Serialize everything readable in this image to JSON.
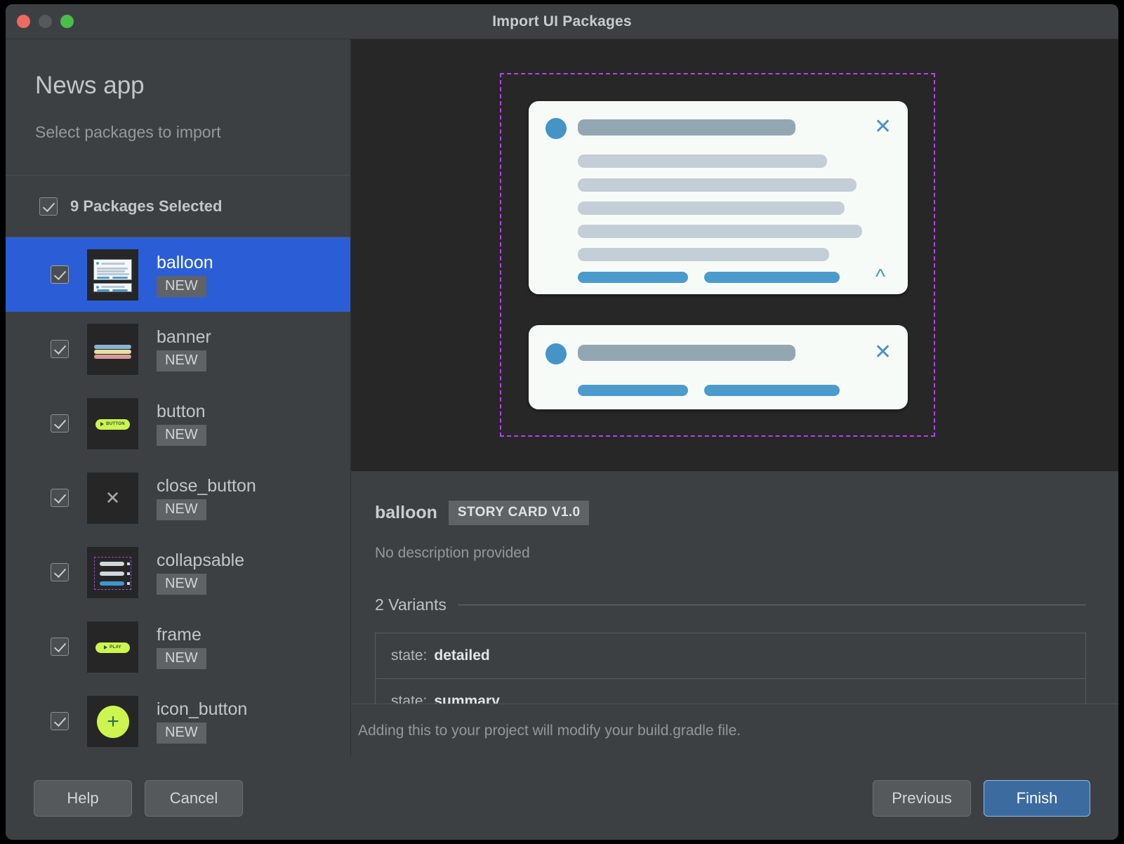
{
  "window": {
    "title": "Import UI Packages",
    "traffic_lights": [
      "close-button",
      "minimize-button",
      "zoom-button"
    ]
  },
  "sidebar": {
    "app_title": "News app",
    "subtitle": "Select packages to import",
    "selection_summary": "9 Packages Selected",
    "packages": [
      {
        "name": "balloon",
        "badge": "NEW",
        "checked": true,
        "selected": true,
        "thumb": "balloon-thumb"
      },
      {
        "name": "banner",
        "badge": "NEW",
        "checked": true,
        "selected": false,
        "thumb": "banner-thumb"
      },
      {
        "name": "button",
        "badge": "NEW",
        "checked": true,
        "selected": false,
        "thumb": "button-thumb",
        "thumb_label": "BUTTON"
      },
      {
        "name": "close_button",
        "badge": "NEW",
        "checked": true,
        "selected": false,
        "thumb": "close-thumb"
      },
      {
        "name": "collapsable",
        "badge": "NEW",
        "checked": true,
        "selected": false,
        "thumb": "collapsable-thumb"
      },
      {
        "name": "frame",
        "badge": "NEW",
        "checked": true,
        "selected": false,
        "thumb": "frame-thumb",
        "thumb_label": "PLAY"
      },
      {
        "name": "icon_button",
        "badge": "NEW",
        "checked": true,
        "selected": false,
        "thumb": "icon-thumb"
      }
    ]
  },
  "preview": {
    "selection_frame_color": "#b341ef",
    "card_bg": "#f7fbf7",
    "accent_blue": "#4b9bcd",
    "title_bar_color": "#93a7b3",
    "text_bar_color": "#c3ced6",
    "close_glyph": "✕",
    "collapse_glyph": "⌃"
  },
  "details": {
    "name": "balloon",
    "badge": "STORY CARD V1.0",
    "description": "No description provided",
    "variants_title": "2 Variants",
    "variants": [
      {
        "key": "state:",
        "value": "detailed"
      },
      {
        "key": "state:",
        "value": "summary"
      }
    ]
  },
  "footnote": "Adding this to your project will modify your build.gradle file.",
  "footer": {
    "help": "Help",
    "cancel": "Cancel",
    "previous": "Previous",
    "finish": "Finish"
  }
}
